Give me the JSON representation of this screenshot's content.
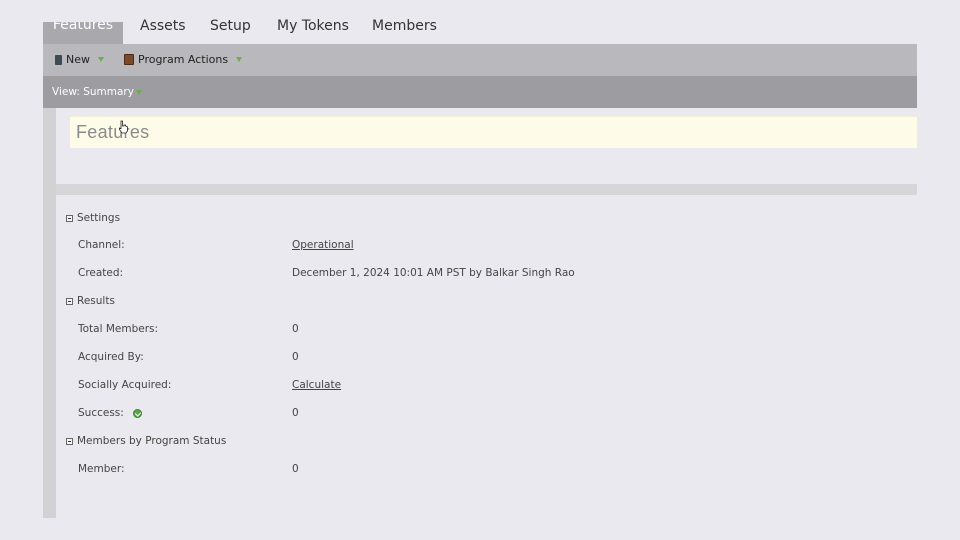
{
  "tabs": [
    {
      "label": "Features",
      "active": true
    },
    {
      "label": "Assets"
    },
    {
      "label": "Setup"
    },
    {
      "label": "My Tokens"
    },
    {
      "label": "Members"
    }
  ],
  "toolbar": {
    "new_label": "New",
    "program_actions_label": "Program Actions",
    "new_icon": "document-icon",
    "program_icon": "book-icon"
  },
  "viewbar": {
    "label": "View: Summary"
  },
  "page_title": "Features",
  "sections": {
    "settings": {
      "title": "Settings",
      "channel_label": "Channel:",
      "channel_value": "Operational",
      "created_label": "Created:",
      "created_value": "December 1, 2024 10:01 AM PST by Balkar Singh Rao"
    },
    "results": {
      "title": "Results",
      "total_members_label": "Total Members:",
      "total_members_value": "0",
      "acquired_by_label": "Acquired By:",
      "acquired_by_value": "0",
      "socially_acquired_label": "Socially Acquired:",
      "socially_acquired_value": "Calculate",
      "success_label": "Success:",
      "success_value": "0"
    },
    "members_by_status": {
      "title": "Members by Program Status",
      "member_label": "Member:",
      "member_value": "0"
    }
  },
  "colors": {
    "accent_green": "#6cae4a",
    "toolbar": "#b9b9bd",
    "viewbar": "#9c9ca1"
  }
}
